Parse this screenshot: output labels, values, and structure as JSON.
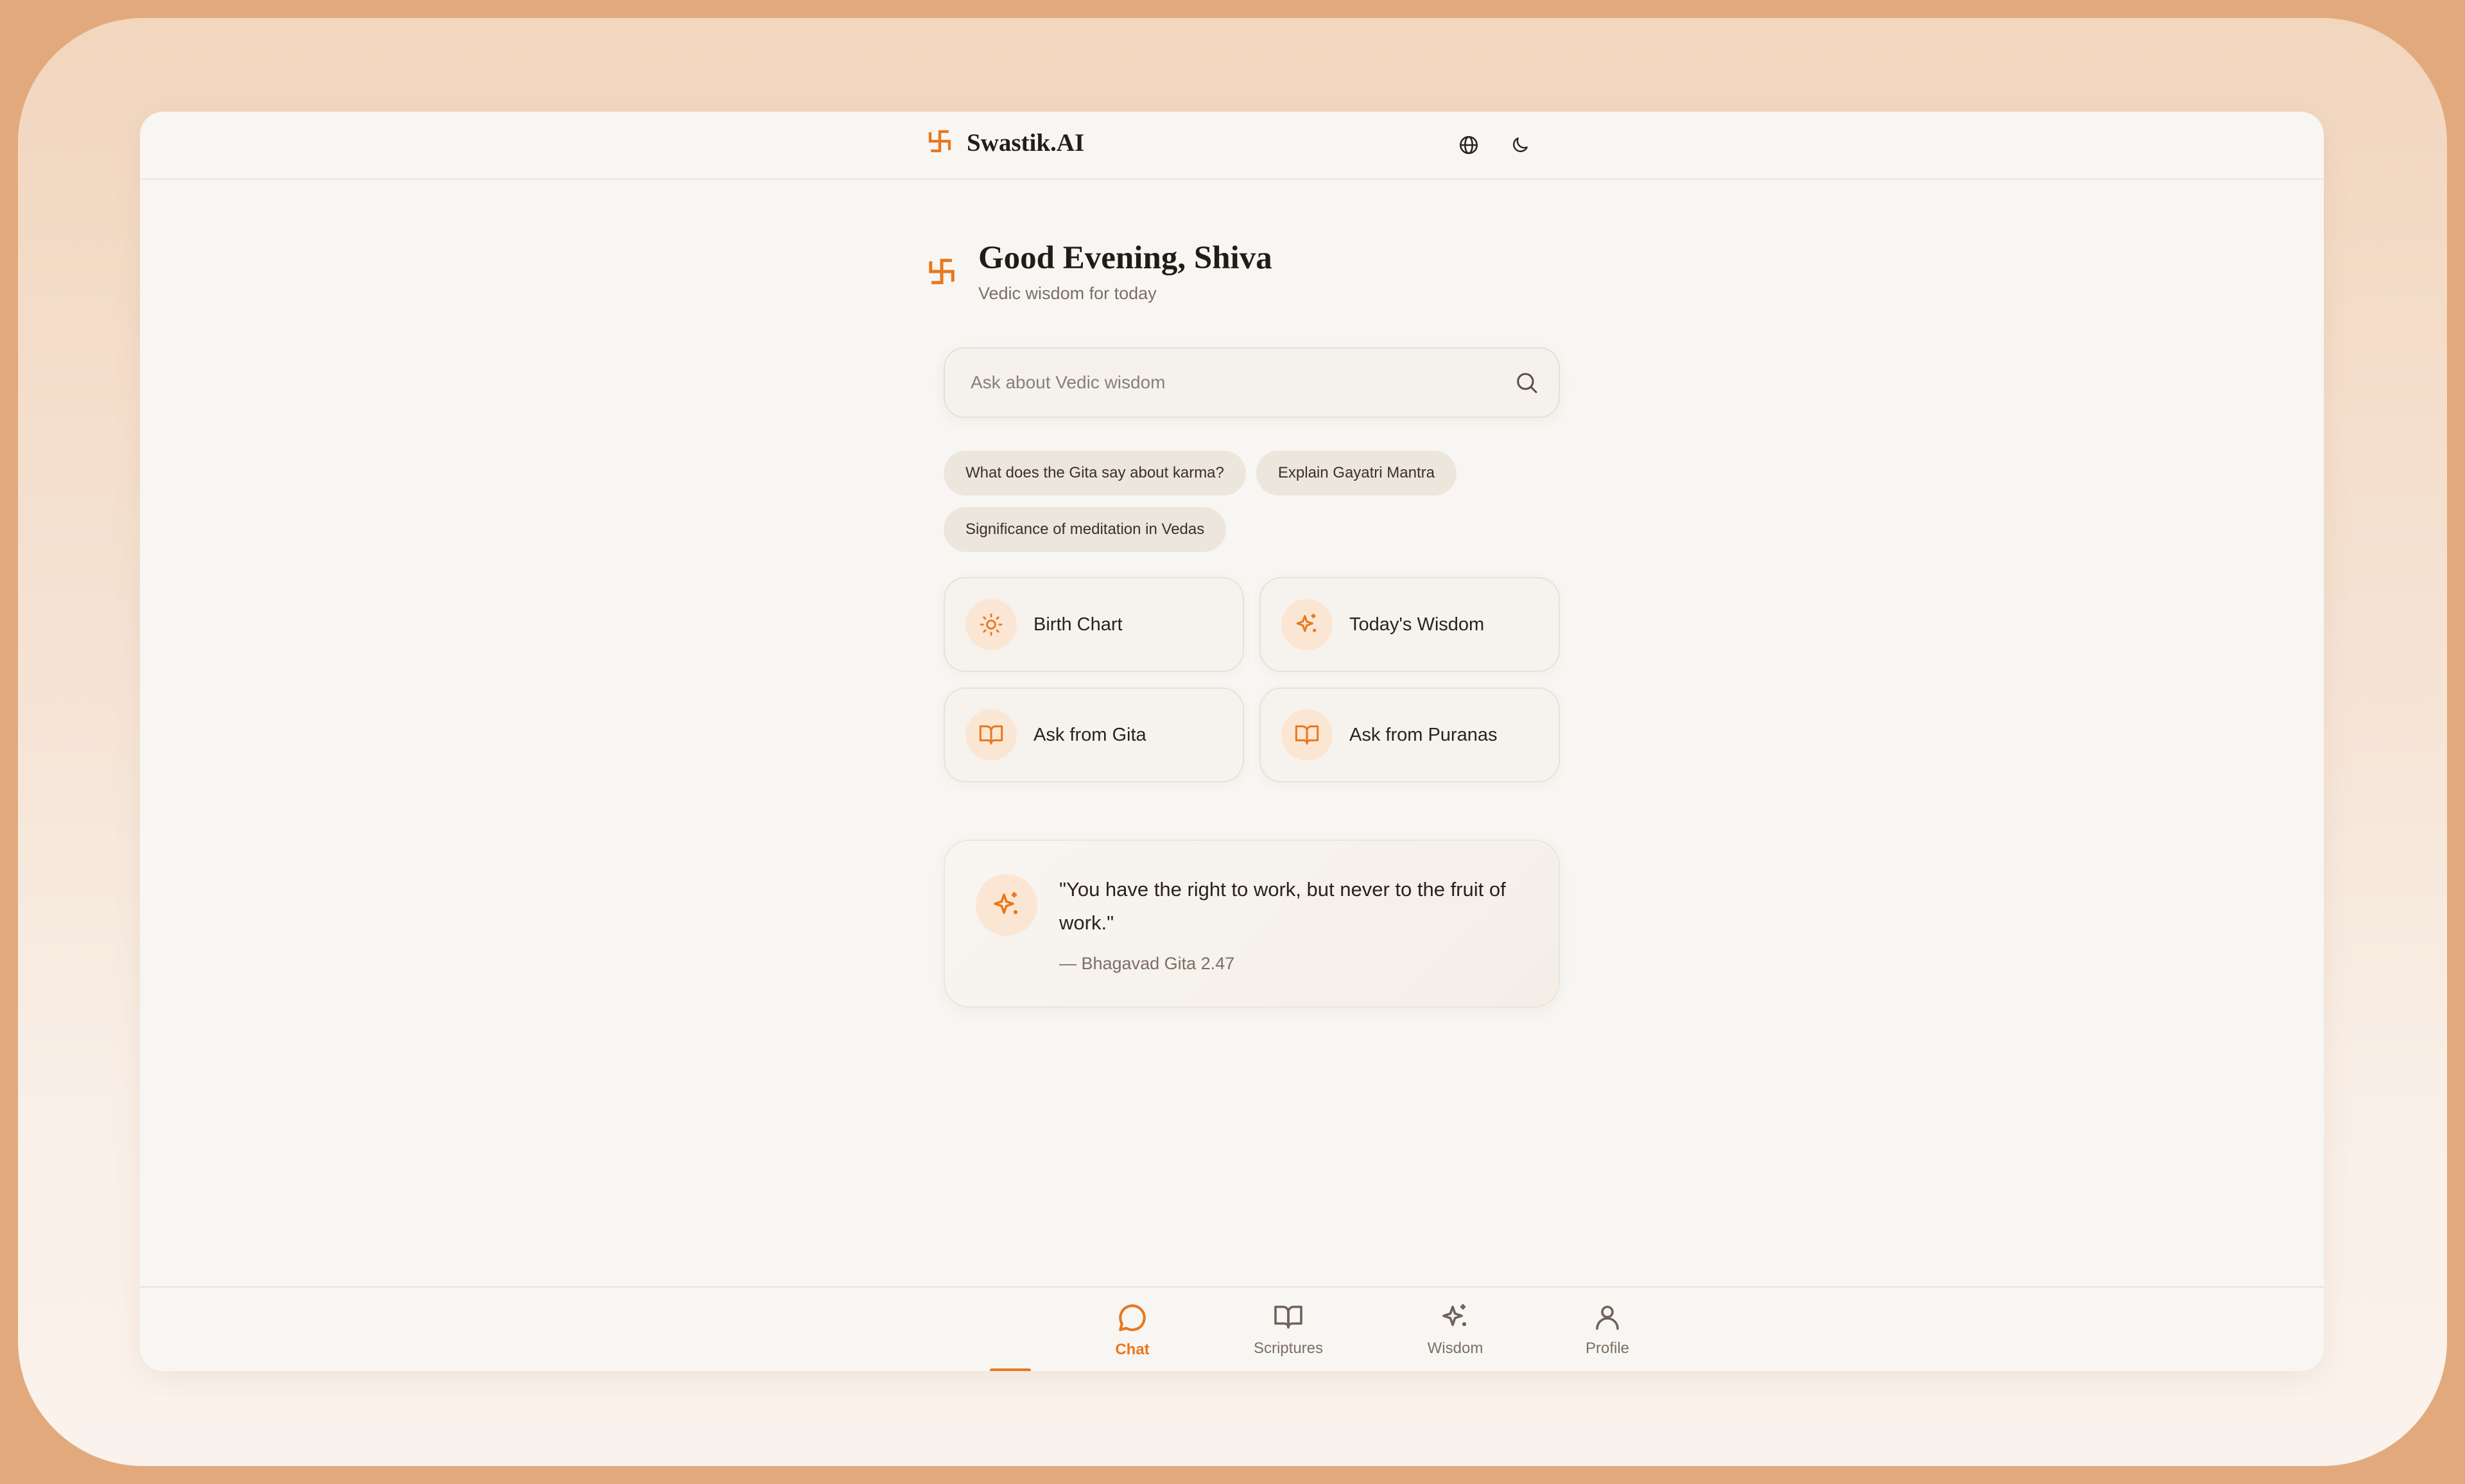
{
  "app": {
    "brand": "Swastik.AI"
  },
  "header": {
    "language_icon": "globe-icon",
    "theme_icon": "moon-icon"
  },
  "greeting": {
    "title": "Good Evening, Shiva",
    "subtitle": "Vedic wisdom for today"
  },
  "search": {
    "placeholder": "Ask about Vedic wisdom",
    "icon": "search-icon"
  },
  "suggestions": [
    "What does the Gita say about karma?",
    "Explain Gayatri Mantra",
    "Significance of meditation in Vedas"
  ],
  "actions": [
    {
      "label": "Birth Chart",
      "icon": "sun-icon"
    },
    {
      "label": "Today's Wisdom",
      "icon": "sparkles-icon"
    },
    {
      "label": "Ask from Gita",
      "icon": "book-icon"
    },
    {
      "label": "Ask from Puranas",
      "icon": "book-icon"
    }
  ],
  "quote": {
    "text": "\"You have the right to work, but never to the fruit of work.\"",
    "source": "— Bhagavad Gita 2.47",
    "icon": "sparkles-icon"
  },
  "nav": {
    "active": "Chat",
    "items": [
      {
        "label": "Chat",
        "icon": "chat-bubble-icon"
      },
      {
        "label": "Scriptures",
        "icon": "book-icon"
      },
      {
        "label": "Wisdom",
        "icon": "sparkles-icon"
      },
      {
        "label": "Profile",
        "icon": "user-icon"
      }
    ]
  },
  "colors": {
    "accent": "#e8771e",
    "background": "#f8f6f2",
    "chip": "#ede6dc",
    "frame": "#e2aa7c"
  }
}
